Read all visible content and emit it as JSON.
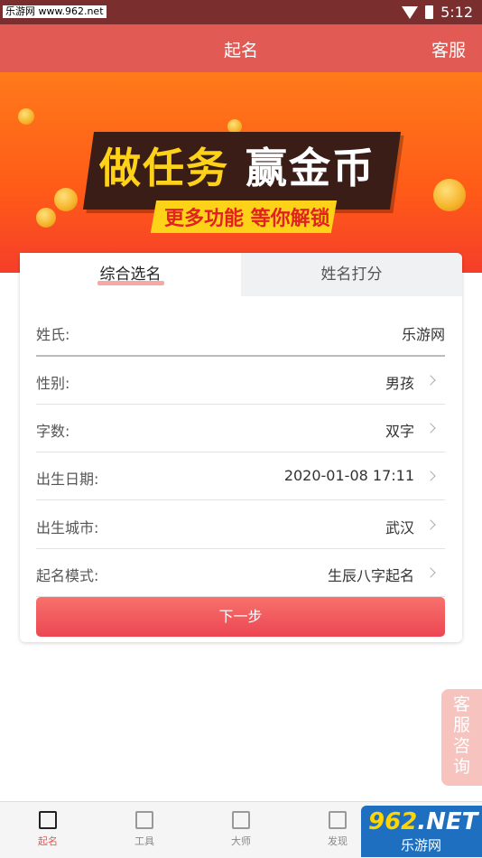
{
  "status_bar": {
    "site_label": "乐游网 www.962.net",
    "time": "5:12"
  },
  "header": {
    "title": "起名",
    "service": "客服"
  },
  "banner": {
    "main_part1": "做任务",
    "main_part2": "赢金币",
    "sub": "更多功能 等你解锁"
  },
  "tabs": [
    {
      "label": "综合选名",
      "active": true
    },
    {
      "label": "姓名打分",
      "active": false
    }
  ],
  "form": {
    "rows": [
      {
        "label": "姓氏:",
        "value": "乐游网"
      },
      {
        "label": "性别:",
        "value": "男孩"
      },
      {
        "label": "字数:",
        "value": "双字"
      },
      {
        "label": "出生日期:",
        "value": "2020-01-08 17:11"
      },
      {
        "label": "出生城市:",
        "value": "武汉"
      },
      {
        "label": "起名模式:",
        "value": "生辰八字起名"
      }
    ],
    "next_button": "下一步"
  },
  "float_service": [
    "客",
    "服",
    "咨",
    "询"
  ],
  "tab_bar": [
    {
      "label": "起名",
      "icon": "edit-icon",
      "active": true
    },
    {
      "label": "工具",
      "icon": "tools-icon",
      "active": false
    },
    {
      "label": "大师",
      "icon": "master-icon",
      "active": false
    },
    {
      "label": "发现",
      "icon": "discover-icon",
      "active": false
    }
  ],
  "watermark": {
    "top_num": "962",
    "top_suffix": ".NET",
    "bottom": "乐游网"
  },
  "colors": {
    "accent": "#e25a54",
    "status_bar": "#7a2e2e",
    "button": "#ec4652",
    "banner_orange": "#ff6a1a"
  }
}
